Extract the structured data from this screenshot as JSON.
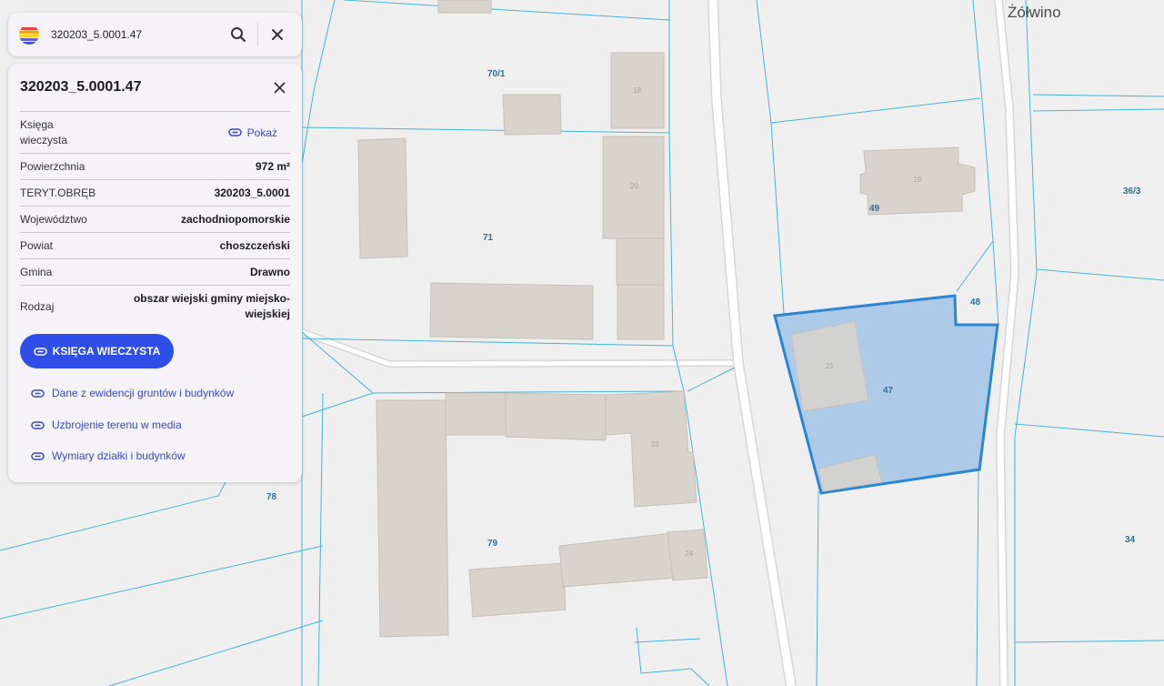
{
  "search": {
    "value": "320203_5.0001.47"
  },
  "panel": {
    "title": "320203_5.0001.47",
    "rows": [
      {
        "label": "Księga wieczysta",
        "link": "Pokaż"
      },
      {
        "label": "Powierzchnia",
        "value": "972 m²"
      },
      {
        "label": "TERYT.OBRĘB",
        "value": "320203_5.0001"
      },
      {
        "label": "Województwo",
        "value": "zachodniopomorskie"
      },
      {
        "label": "Powiat",
        "value": "choszczeński"
      },
      {
        "label": "Gmina",
        "value": "Drawno"
      },
      {
        "label": "Rodzaj",
        "value": "obszar wiejski gminy miejsko-wiejskiej"
      }
    ],
    "primary_button": "KSIĘGA WIECZYSTA",
    "links": [
      "Dane z ewidencji gruntów i budynków",
      "Uzbrojenie terenu w media",
      "Wymiary działki i budynków"
    ]
  },
  "map": {
    "place_label": "Żółwino",
    "parcel_labels": [
      "70/1",
      "71",
      "49",
      "36/3",
      "48",
      "47",
      "78",
      "79",
      "34"
    ],
    "building_labels": [
      "18",
      "20",
      "19",
      "21",
      "22",
      "24"
    ],
    "selected_parcel": "47",
    "colors": {
      "parcel_line": "#42b4d6",
      "building": "#d8d3cc",
      "selection_fill": "#a9c8e8",
      "selection_stroke": "#2a86d4",
      "road": "#ffffff"
    }
  },
  "icons": {
    "logo": "geoportal-logo-icon",
    "search": "search-icon",
    "clear": "close-icon",
    "link": "link-icon"
  },
  "colors": {
    "accent": "#2f4ee8",
    "link": "#3b48c8",
    "panel_bg": "#f5f2f8"
  }
}
